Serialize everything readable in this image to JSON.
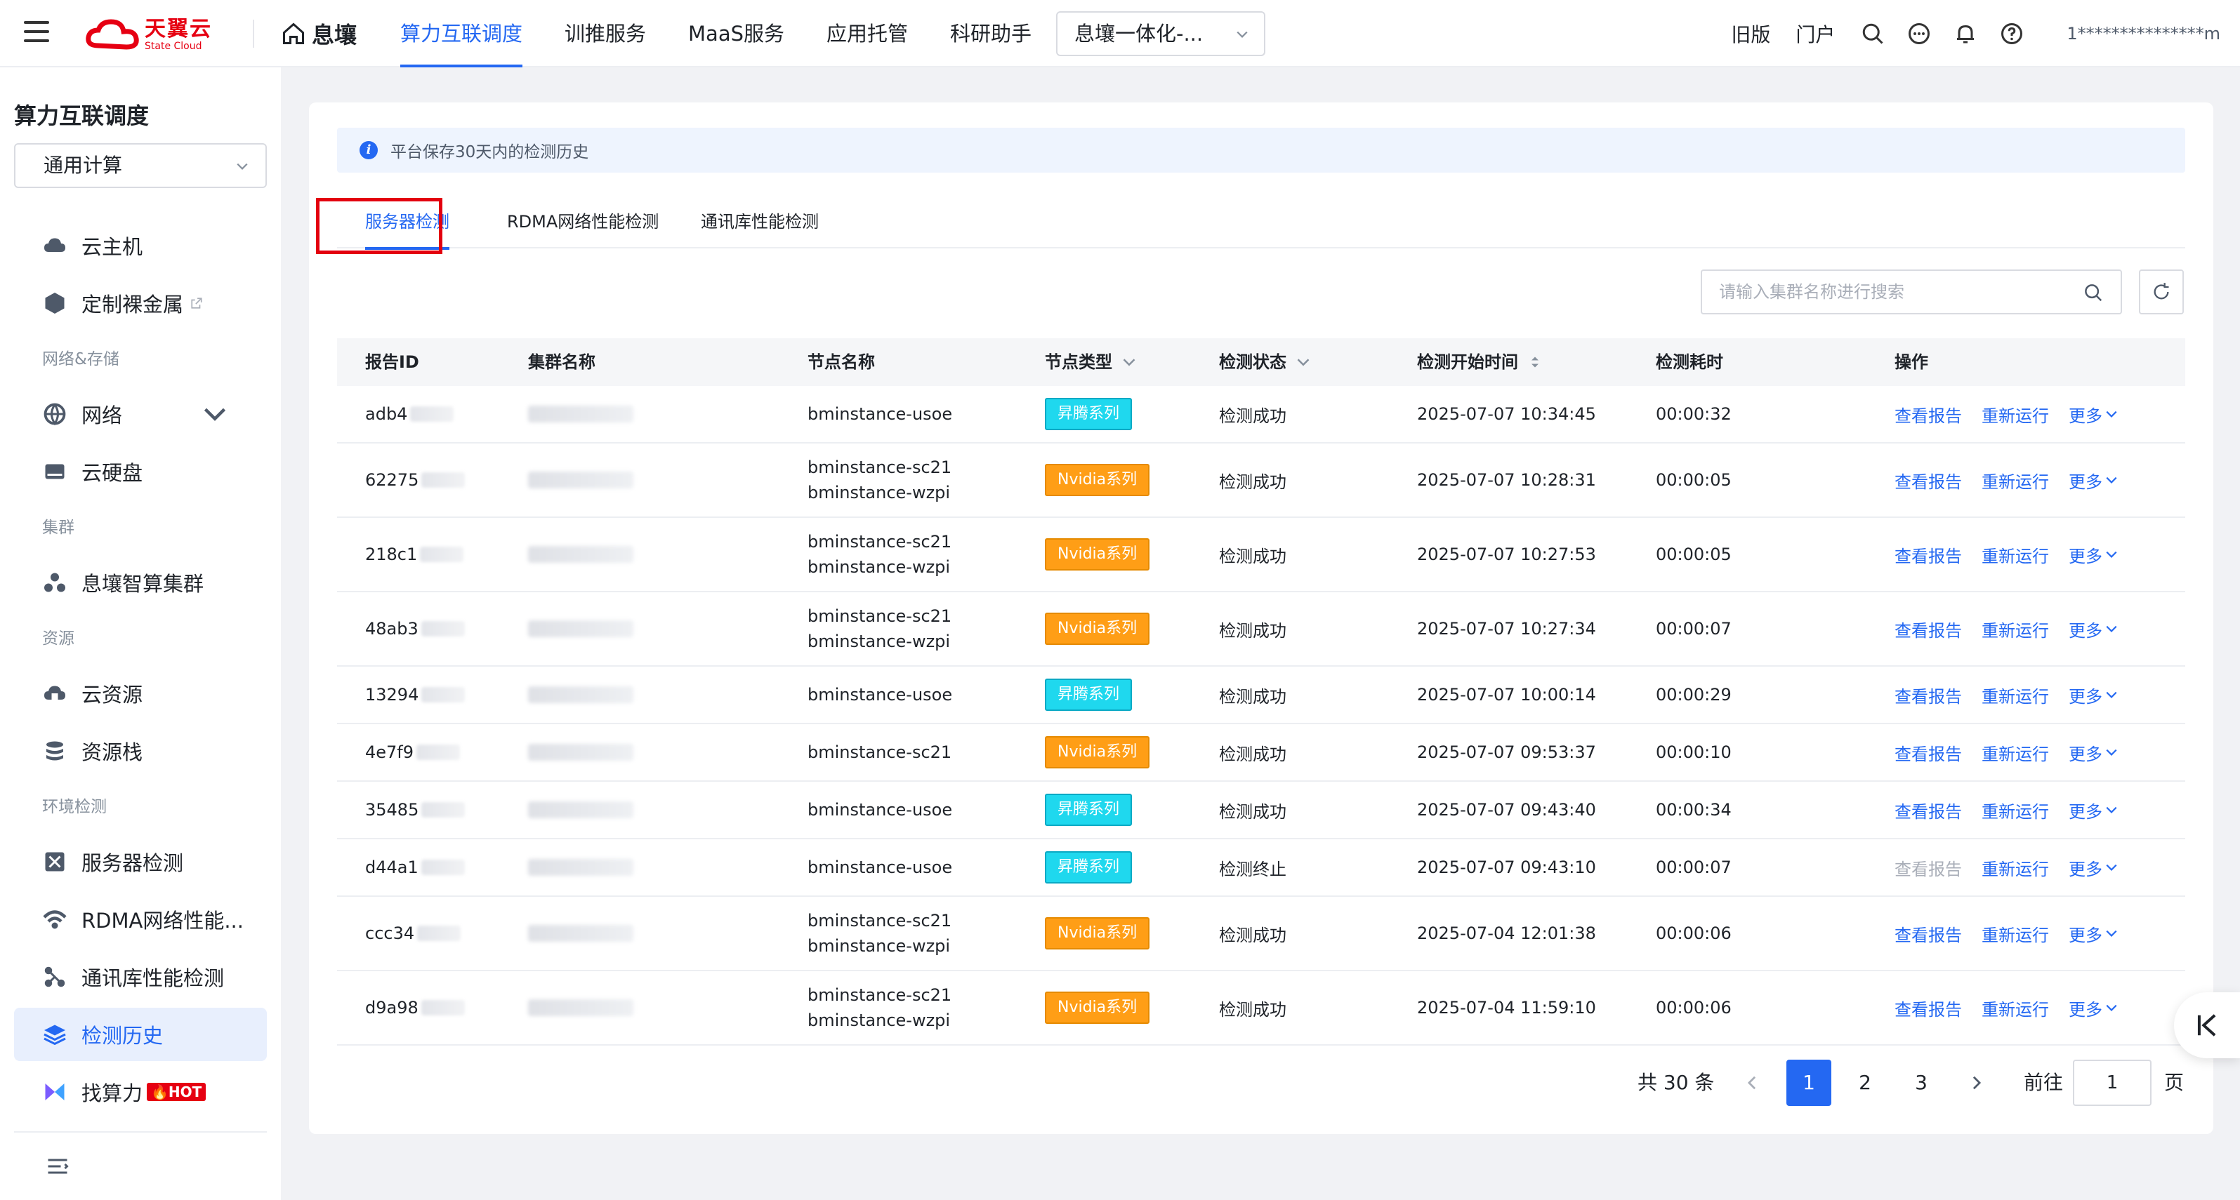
{
  "brand": {
    "name_cn": "天翼云",
    "name_en": "State Cloud",
    "color": "#e60012"
  },
  "topnav": {
    "home": "息壤",
    "items": [
      "算力互联调度",
      "训推服务",
      "MaaS服务",
      "应用托管",
      "科研助手"
    ],
    "active_index": 0,
    "workspace_select": "息壤一体化-...",
    "right_links": [
      "旧版",
      "门户"
    ],
    "user": "1***************m"
  },
  "sidebar": {
    "title": "算力互联调度",
    "select_value": "通用计算",
    "items": [
      {
        "label": "云主机",
        "icon": "cloud-host-icon"
      },
      {
        "label": "定制裸金属",
        "icon": "bare-metal-icon"
      },
      {
        "group": "网络&存储"
      },
      {
        "label": "网络",
        "icon": "globe-icon",
        "expandable": true
      },
      {
        "label": "云硬盘",
        "icon": "disk-icon"
      },
      {
        "group": "集群"
      },
      {
        "label": "息壤智算集群",
        "icon": "cluster-icon"
      },
      {
        "group": "资源"
      },
      {
        "label": "云资源",
        "icon": "cloud-resource-icon"
      },
      {
        "label": "资源栈",
        "icon": "stack-icon"
      },
      {
        "group": "环境检测"
      },
      {
        "label": "服务器检测",
        "icon": "server-check-icon"
      },
      {
        "label": "RDMA网络性能...",
        "icon": "rdma-icon"
      },
      {
        "label": "通讯库性能检测",
        "icon": "comm-lib-icon"
      },
      {
        "label": "检测历史",
        "icon": "layers-icon",
        "active": true
      },
      {
        "label": "找算力",
        "icon": "find-power-icon",
        "badge": "HOT"
      }
    ]
  },
  "main": {
    "notice": "平台保存30天内的检测历史",
    "tabs": [
      "服务器检测",
      "RDMA网络性能检测",
      "通讯库性能检测"
    ],
    "active_tab": 0,
    "search_placeholder": "请输入集群名称进行搜索",
    "columns": [
      "报告ID",
      "集群名称",
      "节点名称",
      "节点类型",
      "检测状态",
      "检测开始时间",
      "检测耗时",
      "操作"
    ],
    "actions": {
      "view": "查看报告",
      "rerun": "重新运行",
      "more": "更多"
    },
    "rows": [
      {
        "id": "adb4",
        "nodes": [
          "bminstance-usoe"
        ],
        "type": "昇腾系列",
        "type_kind": "ascend",
        "status": "检测成功",
        "start": "2025-07-07 10:34:45",
        "duration": "00:00:32",
        "view_enabled": true
      },
      {
        "id": "62275",
        "nodes": [
          "bminstance-sc21",
          "bminstance-wzpi"
        ],
        "type": "Nvidia系列",
        "type_kind": "nvidia",
        "status": "检测成功",
        "start": "2025-07-07 10:28:31",
        "duration": "00:00:05",
        "view_enabled": true
      },
      {
        "id": "218c1",
        "nodes": [
          "bminstance-sc21",
          "bminstance-wzpi"
        ],
        "type": "Nvidia系列",
        "type_kind": "nvidia",
        "status": "检测成功",
        "start": "2025-07-07 10:27:53",
        "duration": "00:00:05",
        "view_enabled": true
      },
      {
        "id": "48ab3",
        "nodes": [
          "bminstance-sc21",
          "bminstance-wzpi"
        ],
        "type": "Nvidia系列",
        "type_kind": "nvidia",
        "status": "检测成功",
        "start": "2025-07-07 10:27:34",
        "duration": "00:00:07",
        "view_enabled": true
      },
      {
        "id": "13294",
        "nodes": [
          "bminstance-usoe"
        ],
        "type": "昇腾系列",
        "type_kind": "ascend",
        "status": "检测成功",
        "start": "2025-07-07 10:00:14",
        "duration": "00:00:29",
        "view_enabled": true
      },
      {
        "id": "4e7f9",
        "nodes": [
          "bminstance-sc21"
        ],
        "type": "Nvidia系列",
        "type_kind": "nvidia",
        "status": "检测成功",
        "start": "2025-07-07 09:53:37",
        "duration": "00:00:10",
        "view_enabled": true
      },
      {
        "id": "35485",
        "nodes": [
          "bminstance-usoe"
        ],
        "type": "昇腾系列",
        "type_kind": "ascend",
        "status": "检测成功",
        "start": "2025-07-07 09:43:40",
        "duration": "00:00:34",
        "view_enabled": true
      },
      {
        "id": "d44a1",
        "nodes": [
          "bminstance-usoe"
        ],
        "type": "昇腾系列",
        "type_kind": "ascend",
        "status": "检测终止",
        "start": "2025-07-07 09:43:10",
        "duration": "00:00:07",
        "view_enabled": false
      },
      {
        "id": "ccc34",
        "nodes": [
          "bminstance-sc21",
          "bminstance-wzpi"
        ],
        "type": "Nvidia系列",
        "type_kind": "nvidia",
        "status": "检测成功",
        "start": "2025-07-04 12:01:38",
        "duration": "00:00:06",
        "view_enabled": true
      },
      {
        "id": "d9a98",
        "nodes": [
          "bminstance-sc21",
          "bminstance-wzpi"
        ],
        "type": "Nvidia系列",
        "type_kind": "nvidia",
        "status": "检测成功",
        "start": "2025-07-04 11:59:10",
        "duration": "00:00:06",
        "view_enabled": true
      }
    ],
    "pagination": {
      "total": "共 30 条",
      "pages": [
        "1",
        "2",
        "3"
      ],
      "current": "1",
      "goto_label": "前往",
      "goto_value": "1",
      "suffix": "页"
    }
  },
  "colors": {
    "primary": "#2468f2",
    "ascend": "#1fd8ee",
    "nvidia": "#ff9e16",
    "highlight": "#e3000f"
  }
}
